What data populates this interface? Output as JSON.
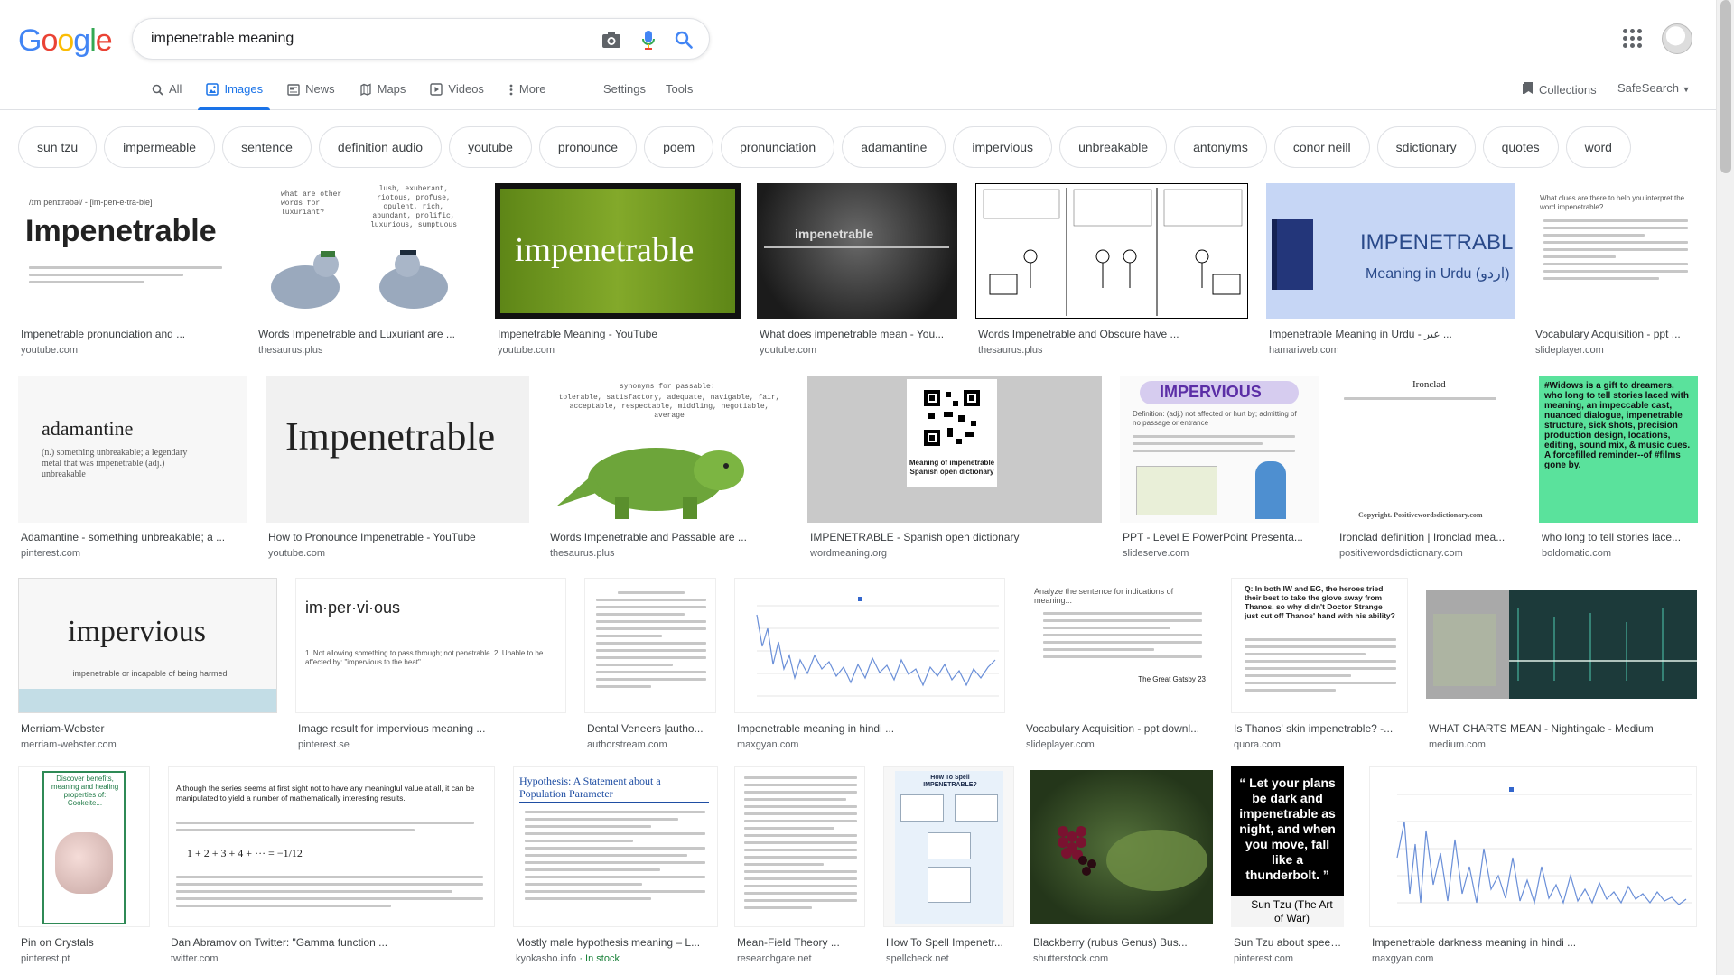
{
  "logo": {
    "letters": [
      "G",
      "o",
      "o",
      "g",
      "l",
      "e"
    ],
    "colors": [
      "#4285f4",
      "#ea4335",
      "#fbbc05",
      "#4285f4",
      "#34a853",
      "#ea4335"
    ]
  },
  "search": {
    "query": "impenetrable meaning"
  },
  "tabs": [
    {
      "label": "All",
      "icon": "search-icon"
    },
    {
      "label": "Images",
      "icon": "images-icon",
      "active": true
    },
    {
      "label": "News",
      "icon": "news-icon"
    },
    {
      "label": "Maps",
      "icon": "maps-icon"
    },
    {
      "label": "Videos",
      "icon": "videos-icon"
    },
    {
      "label": "More",
      "icon": "more-icon"
    }
  ],
  "tools": {
    "settings": "Settings",
    "tools": "Tools",
    "collections": "Collections",
    "safesearch": "SafeSearch"
  },
  "chips": [
    "sun tzu",
    "impermeable",
    "sentence",
    "definition audio",
    "youtube",
    "pronounce",
    "poem",
    "pronunciation",
    "adamantine",
    "impervious",
    "unbreakable",
    "antonyms",
    "conor neill",
    "sdictionary",
    "quotes",
    "word"
  ],
  "results": [
    [
      {
        "caption": "Impenetrable pronunciation and ...",
        "source": "youtube.com",
        "thumb_text": "Impenetrable",
        "thumb_sub": "/ɪmˈpenɪtrəbəl/ - [im-pen-e-tra-ble]"
      },
      {
        "caption": "Words Impenetrable and Luxuriant are ...",
        "source": "thesaurus.plus",
        "thumb_text": "what are other words for luxuriant?",
        "thumb_sub": "lush, exuberant, riotous, profuse, opulent, rich, abundant, prolific, luxurious, sumptuous"
      },
      {
        "caption": "Impenetrable Meaning - YouTube",
        "source": "youtube.com",
        "thumb_text": "impenetrable"
      },
      {
        "caption": "What does impenetrable mean - You...",
        "source": "youtube.com",
        "thumb_text": "impenetrable"
      },
      {
        "caption": "Words Impenetrable and Obscure have ...",
        "source": "thesaurus.plus",
        "thumb_text": ""
      },
      {
        "caption": "Impenetrable Meaning in Urdu - عیر ...",
        "source": "hamariweb.com",
        "thumb_text": "IMPENETRABLE",
        "thumb_sub": "Meaning in Urdu (اردو)"
      },
      {
        "caption": "Vocabulary Acquisition - ppt ...",
        "source": "slideplayer.com",
        "thumb_text": "What clues are there to help you interpret the word impenetrable?"
      }
    ],
    [
      {
        "caption": "Adamantine - something unbreakable; a ...",
        "source": "pinterest.com",
        "thumb_text": "adamantine",
        "thumb_sub": "(n.) something unbreakable; a legendary metal that was impenetrable (adj.) unbreakable"
      },
      {
        "caption": "How to Pronounce Impenetrable - YouTube",
        "source": "youtube.com",
        "thumb_text": "Impenetrable"
      },
      {
        "caption": "Words Impenetrable and Passable are ...",
        "source": "thesaurus.plus",
        "thumb_text": "synonyms for passable:",
        "thumb_sub": "tolerable, satisfactory, adequate, navigable, fair, acceptable, respectable, middling, negotiable, average"
      },
      {
        "caption": "IMPENETRABLE - Spanish open dictionary",
        "source": "wordmeaning.org",
        "thumb_text": "Meaning of impenetrable",
        "thumb_sub": "Spanish open dictionary"
      },
      {
        "caption": "PPT - Level E PowerPoint Presenta...",
        "source": "slideserve.com",
        "thumb_text": "IMPERVIOUS",
        "thumb_sub": "Definition: (adj.) not affected or hurt by; admitting of no passage or entrance"
      },
      {
        "caption": "Ironclad definition | Ironclad mea...",
        "source": "positivewordsdictionary.com",
        "thumb_text": "Ironclad",
        "thumb_sub": "Copyright. Positivewordsdictionary.com"
      },
      {
        "caption": "who long to tell stories lace...",
        "source": "boldomatic.com",
        "thumb_text": "#Widows is a gift to dreamers, who long to tell stories laced with meaning, an impeccable cast, nuanced dialogue, impenetrable structure, sick shots, precision production design, locations, editing, sound mix, & music cues. A forcefilled reminder--of #films gone by."
      }
    ],
    [
      {
        "caption": "Merriam-Webster",
        "source": "merriam-webster.com",
        "thumb_text": "impervious",
        "thumb_sub": "impenetrable or incapable of being harmed"
      },
      {
        "caption": "Image result for impervious meaning ...",
        "source": "pinterest.se",
        "thumb_text": "im·per·vi·ous",
        "thumb_sub": "1. Not allowing something to pass through; not penetrable. 2. Unable to be affected by: \"impervious to the heat\"."
      },
      {
        "caption": "Dental Veneers |autho...",
        "source": "authorstream.com",
        "thumb_text": ""
      },
      {
        "caption": "Impenetrable meaning in hindi ...",
        "source": "maxgyan.com",
        "thumb_text": ""
      },
      {
        "caption": "Vocabulary Acquisition - ppt downl...",
        "source": "slideplayer.com",
        "thumb_text": "Analyze the sentence for indications of meaning...",
        "thumb_sub": "The Great Gatsby 23"
      },
      {
        "caption": "Is Thanos' skin impenetrable? -...",
        "source": "quora.com",
        "thumb_text": "Q: In both IW and EG, the heroes tried their best to take the glove away from Thanos, so why didn't Doctor Strange just cut off Thanos' hand with his ability?"
      },
      {
        "caption": "WHAT CHARTS MEAN - Nightingale - Medium",
        "source": "medium.com",
        "thumb_text": ""
      }
    ],
    [
      {
        "caption": "Pin on Crystals",
        "source": "pinterest.pt",
        "thumb_text": "Discover benefits, meaning and healing properties of: Cookeite..."
      },
      {
        "caption": "Dan Abramov on Twitter: \"Gamma function ...",
        "source": "twitter.com",
        "thumb_text": "Although the series seems at first sight not to have any meaningful value at all, it can be manipulated to yield a number of mathematically interesting results."
      },
      {
        "caption": "Mostly male hypothesis meaning – L...",
        "source": "kyokasho.info",
        "source_extra": " · In stock",
        "thumb_text": "Hypothesis: A Statement about a Population Parameter"
      },
      {
        "caption": "Mean-Field Theory ...",
        "source": "researchgate.net",
        "thumb_text": ""
      },
      {
        "caption": "How To Spell Impenetr...",
        "source": "spellcheck.net",
        "thumb_text": "How To Spell IMPENETRABLE?"
      },
      {
        "caption": "Blackberry (rubus Genus) Bus...",
        "source": "shutterstock.com",
        "thumb_text": ""
      },
      {
        "caption": "Sun Tzu about speed ...",
        "source": "pinterest.com",
        "thumb_text": "“ Let your plans be dark and impenetrable as night, and when you move, fall like a thunderbolt. ”",
        "thumb_sub": "Sun Tzu (The Art of War)"
      },
      {
        "caption": "Impenetrable darkness meaning in hindi ...",
        "source": "maxgyan.com",
        "thumb_text": ""
      }
    ]
  ]
}
